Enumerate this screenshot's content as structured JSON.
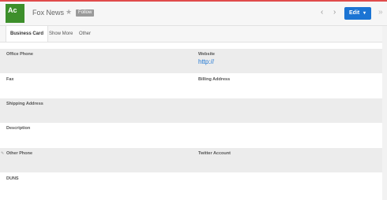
{
  "record": {
    "avatar_text": "Ac",
    "name": "Fox News",
    "follow_label": "Follow"
  },
  "header": {
    "prev_icon": "‹",
    "next_icon": "›",
    "edit_label": "Edit",
    "edit_caret": "▾",
    "more_icon": "»",
    "star_icon": "★"
  },
  "tabs": [
    "Business Card",
    "Show More",
    "Other"
  ],
  "fields": {
    "office_phone": {
      "label": "Office Phone",
      "value": ""
    },
    "website": {
      "label": "Website",
      "value": "http://"
    },
    "fax": {
      "label": "Fax",
      "value": ""
    },
    "billing_address": {
      "label": "Billing Address",
      "value": ""
    },
    "shipping_address": {
      "label": "Shipping Address",
      "value": ""
    },
    "description": {
      "label": "Description",
      "value": ""
    },
    "other_phone": {
      "label": "Other Phone",
      "value": ""
    },
    "twitter_account": {
      "label": "Twitter Account",
      "value": ""
    },
    "duns": {
      "label": "DUNS",
      "value": ""
    }
  },
  "colors": {
    "avatar": "#3d8f2b",
    "accent": "#1b74d3",
    "top_line": "#e04b4b"
  }
}
